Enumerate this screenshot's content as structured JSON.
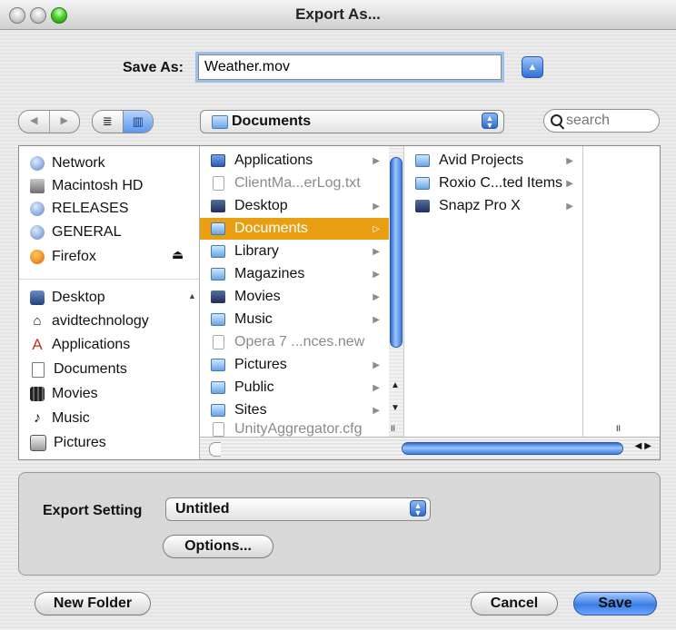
{
  "window": {
    "title": "Export As..."
  },
  "save_as": {
    "label": "Save As:",
    "value": "Weather.mov"
  },
  "toolbar": {
    "back": "◀",
    "forward": "▶",
    "view_list": "≣",
    "view_columns": "▥",
    "location": "Documents",
    "search_placeholder": "search"
  },
  "sidebar": {
    "devices": [
      {
        "label": "Network",
        "icon": "network-globe-icon"
      },
      {
        "label": "Macintosh HD",
        "icon": "hard-disk-icon"
      },
      {
        "label": "RELEASES",
        "icon": "network-volume-icon"
      },
      {
        "label": "GENERAL",
        "icon": "network-volume-icon"
      },
      {
        "label": "Firefox",
        "icon": "firefox-disk-icon"
      }
    ],
    "places": [
      {
        "label": "Desktop",
        "icon": "desktop-icon"
      },
      {
        "label": "avidtechnology",
        "icon": "home-icon"
      },
      {
        "label": "Applications",
        "icon": "applications-icon"
      },
      {
        "label": "Documents",
        "icon": "document-icon"
      },
      {
        "label": "Movies",
        "icon": "movies-icon"
      },
      {
        "label": "Music",
        "icon": "music-icon"
      },
      {
        "label": "Pictures",
        "icon": "pictures-icon"
      }
    ],
    "eject": "⏏"
  },
  "column1": [
    {
      "label": "Applications",
      "type": "folder",
      "arrow": true
    },
    {
      "label": "ClientMa...erLog.txt",
      "type": "file",
      "arrow": false
    },
    {
      "label": "Desktop",
      "type": "folder",
      "arrow": true
    },
    {
      "label": "Documents",
      "type": "folder",
      "arrow": true,
      "selected": true
    },
    {
      "label": "Library",
      "type": "folder",
      "arrow": true
    },
    {
      "label": "Magazines",
      "type": "folder",
      "arrow": true
    },
    {
      "label": "Movies",
      "type": "folder",
      "arrow": true
    },
    {
      "label": "Music",
      "type": "folder",
      "arrow": true
    },
    {
      "label": "Opera 7 ...nces.new",
      "type": "file",
      "arrow": false
    },
    {
      "label": "Pictures",
      "type": "folder",
      "arrow": true
    },
    {
      "label": "Public",
      "type": "folder",
      "arrow": true
    },
    {
      "label": "Sites",
      "type": "folder",
      "arrow": true
    },
    {
      "label": "UnityAggregator.cfg",
      "type": "file",
      "arrow": false
    }
  ],
  "column2": [
    {
      "label": "Avid Projects",
      "type": "folder",
      "arrow": true
    },
    {
      "label": "Roxio C...ted Items",
      "type": "folder",
      "arrow": true
    },
    {
      "label": "Snapz Pro X",
      "type": "app",
      "arrow": true
    }
  ],
  "export": {
    "label": "Export Setting",
    "value": "Untitled",
    "options_button": "Options..."
  },
  "buttons": {
    "new_folder": "New Folder",
    "cancel": "Cancel",
    "save": "Save"
  },
  "colors": {
    "selection": "#e8a012",
    "accent_blue": "#3b7de6"
  }
}
